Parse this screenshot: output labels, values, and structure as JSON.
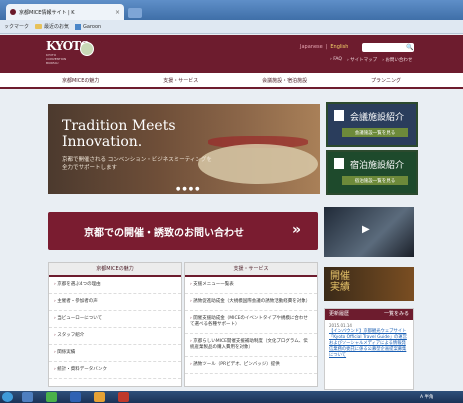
{
  "browser": {
    "tab_title": "京都MICE情報サイト | K",
    "tab_close": "×",
    "bookmarks": [
      {
        "label": "ックマーク",
        "type": "text"
      },
      {
        "label": "最近のお気",
        "type": "folder"
      },
      {
        "label": "Garoon",
        "type": "square"
      }
    ]
  },
  "header": {
    "logo_text": "KYOTO",
    "logo_sub": "KYOTO CONVENTION BUREAU",
    "lang_japanese": "Japanese",
    "lang_sep": "|",
    "lang_english": "English",
    "links": [
      "› FAQ",
      "› サイトマップ",
      "› お問い合わせ"
    ],
    "search_icon": "🔍"
  },
  "nav": [
    "京都MICEの魅力",
    "支援・サービス",
    "会議施設・宿泊施設",
    "プランニング"
  ],
  "hero": {
    "title_line1": "Tradition Meets",
    "title_line2": "Innovation.",
    "subtitle": "京都で開催される コンベンション・ビジネスミーティングを 全力でサポートします",
    "dots": "●●●●"
  },
  "side": {
    "venue_title": "会議施設紹介",
    "venue_btn": "会議施設一覧を見る",
    "lodging_title": "宿泊施設紹介",
    "lodging_btn": "宿泊施設一覧を見る"
  },
  "inquiry": {
    "text": "京都での開催・誘致のお問い合わせ",
    "arrow": "»"
  },
  "kaisai": {
    "line1": "開催",
    "line2": "実績"
  },
  "menu1": {
    "head": "京都MICEの魅力",
    "items": [
      "京都を選ぶ4つの理由",
      "主催者・参加者の声",
      "当ビューローについて",
      "スタッフ紹介",
      "関係実績",
      "統計・資料データバンク"
    ]
  },
  "menu2": {
    "head": "支援・サービス",
    "items": [
      "支援メニュー一覧表",
      "誘致促進助成金（大規模国際会議の誘致活動経費を対象）",
      "開催支援助成金（MICEのイベントタイプや規模に合わせて選べる各種サポート）",
      "京都らしいMICE開催支援補助制度（文化プログラム、伝統産業製品の購入費用を対象）",
      "誘致ツール（PRビデオ、ピンバッジ）提供"
    ]
  },
  "news": {
    "head": "更新履歴",
    "more": "一覧をみる",
    "date": "2015.01.14",
    "body": "【インバウンド】京都観光ウェブサイト「Kyoto Official Travel Guide」の運営およびソーシャルメディアによる情報発信業務の委託に係る公募型企画提案募集について"
  },
  "taskbar": {
    "tray": "A 半角"
  }
}
